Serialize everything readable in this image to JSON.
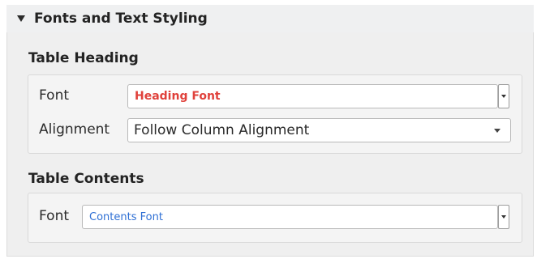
{
  "group": {
    "title": "Fonts and Text Styling",
    "collapse_icon": "triangle-down-icon"
  },
  "table_heading": {
    "title": "Table Heading",
    "font_label": "Font",
    "font_value": "Heading Font",
    "font_color": "#e0413b",
    "alignment_label": "Alignment",
    "alignment_value": "Follow Column Alignment"
  },
  "table_contents": {
    "title": "Table Contents",
    "font_label": "Font",
    "font_value": "Contents Font",
    "font_color": "#2e6fd4"
  }
}
